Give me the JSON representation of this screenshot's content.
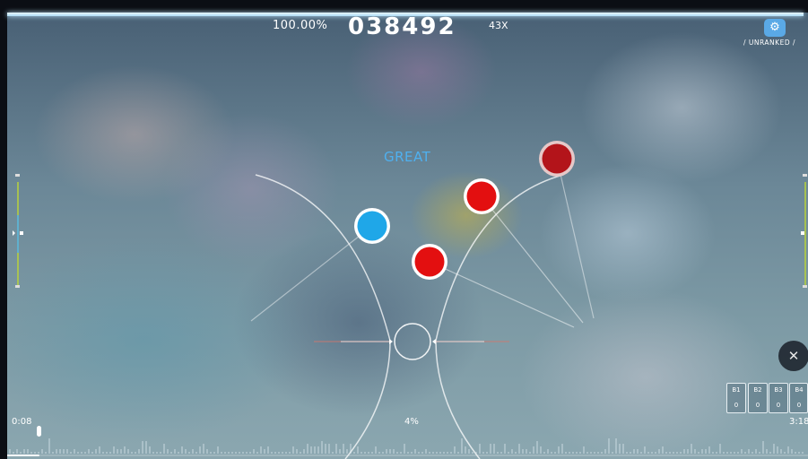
{
  "hud": {
    "accuracy": "100.00%",
    "score": "038492",
    "combo": "43X",
    "ranking": "/ UNRANKED /",
    "judgement": "GREAT",
    "health": 1.0
  },
  "progress": {
    "elapsed": "0:08",
    "percent_label": "4%",
    "total": "3:18",
    "fraction": 0.04
  },
  "key_overlay": [
    {
      "label": "B1",
      "count": "0"
    },
    {
      "label": "B2",
      "count": "0"
    },
    {
      "label": "B3",
      "count": "0"
    },
    {
      "label": "B4",
      "count": "0"
    }
  ],
  "buttons": {
    "settings_icon": "gear-icon",
    "close_icon": "close-icon",
    "close_glyph": "✕",
    "settings_glyph": "⚙"
  },
  "colors": {
    "blue_note": "#1fa7e8",
    "red_note": "#e30f10",
    "dark_red_note": "#b3141a",
    "judgement_text": "#4fb0ef",
    "settings_button": "#5aa9e6"
  }
}
